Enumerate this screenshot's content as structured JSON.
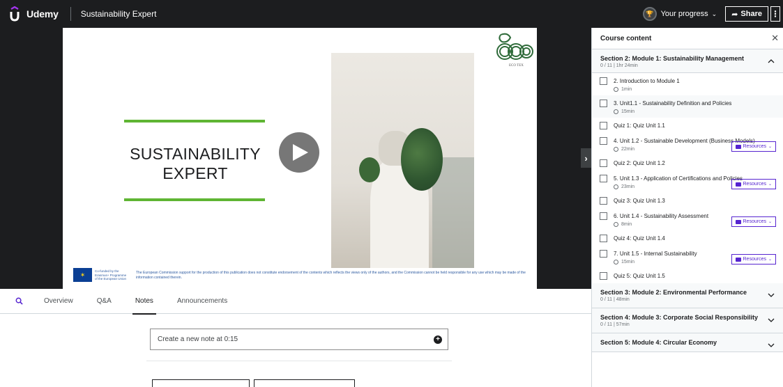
{
  "brand": {
    "name": "Udemy",
    "accent": "#a435f0"
  },
  "header": {
    "course_title": "Sustainability Expert",
    "progress_label": "Your progress",
    "share_label": "Share"
  },
  "slide": {
    "title_line1": "SUSTAINABILITY",
    "title_line2": "EXPERT",
    "logo_text": "ECO TEX",
    "eu_text": "Co-funded by the Erasmus+ Programme of the European Union",
    "disclaimer": "The European Commission support for the production of this publication does not constitute endorsement of the contents which reflects the views only of the authors, and the Commission cannot be held responsible for any use which may be made of the information contained therein.",
    "accent_line_color": "#5fb533"
  },
  "tabs": {
    "items": [
      {
        "label": "Overview"
      },
      {
        "label": "Q&A"
      },
      {
        "label": "Notes"
      },
      {
        "label": "Announcements"
      }
    ],
    "active": "Notes"
  },
  "notes": {
    "create_label": "Create a new note at 0:15"
  },
  "sidebar": {
    "title": "Course content",
    "open_section": {
      "title": "Section 2: Module 1: Sustainability Management",
      "meta": "0 / 11 | 1hr 24min"
    },
    "lectures": [
      {
        "title": "2. Introduction to Module 1",
        "time": "1min",
        "resources": false
      },
      {
        "title": "3. Unit1.1 - Sustainability Definition and Policies",
        "time": "15min",
        "resources": false
      },
      {
        "title": "Quiz 1: Quiz Unit 1.1",
        "time": "",
        "resources": false
      },
      {
        "title": "4. Unit 1.2 - Sustainable Development (Business Models)",
        "time": "22min",
        "resources": true
      },
      {
        "title": "Quiz 2: Quiz Unit 1.2",
        "time": "",
        "resources": false
      },
      {
        "title": "5. Unit 1.3 - Application of Certifications and Policies",
        "time": "23min",
        "resources": true
      },
      {
        "title": "Quiz 3: Quiz Unit 1.3",
        "time": "",
        "resources": false
      },
      {
        "title": "6. Unit 1.4 - Sustainability Assessment",
        "time": "8min",
        "resources": true
      },
      {
        "title": "Quiz 4: Quiz Unit 1.4",
        "time": "",
        "resources": false
      },
      {
        "title": "7. Unit 1.5 - Internal Sustainability",
        "time": "15min",
        "resources": true
      },
      {
        "title": "Quiz 5: Quiz Unit 1.5",
        "time": "",
        "resources": false
      }
    ],
    "resources_label": "Resources",
    "collapsed_sections": [
      {
        "title": "Section 3: Module 2: Environmental Performance",
        "meta": "0 / 11 | 48min"
      },
      {
        "title": "Section 4: Module 3: Corporate Social Responsibility",
        "meta": "0 / 11 | 57min"
      },
      {
        "title": "Section 5: Module 4: Circular Economy",
        "meta": ""
      }
    ]
  }
}
